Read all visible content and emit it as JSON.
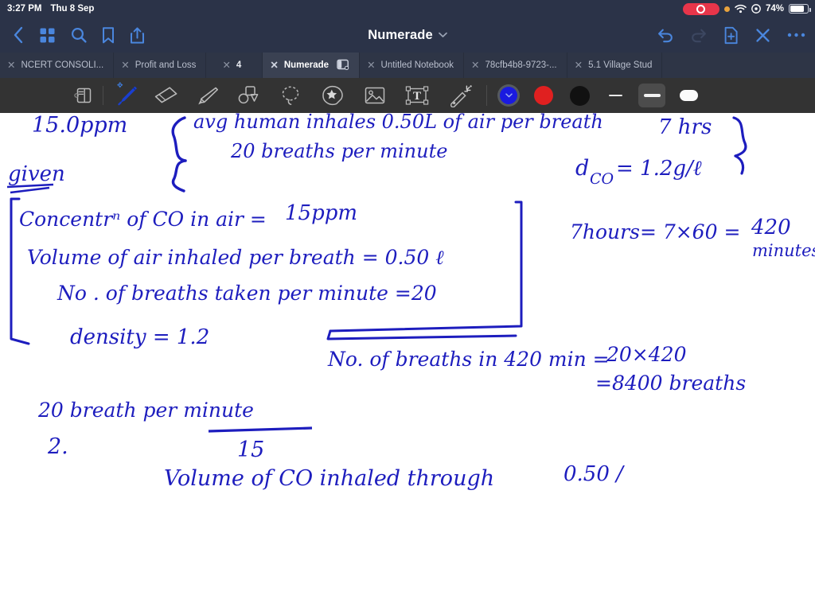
{
  "status_bar": {
    "time": "3:27 PM",
    "date": "Thu 8 Sep",
    "battery_percent": "74%",
    "icons": [
      "record-pill-icon",
      "orange-dot-icon",
      "wifi-icon",
      "location-icon",
      "battery-icon"
    ],
    "colors": {
      "background": "#2b3348",
      "record_red": "#e8354a",
      "orange": "#e8a33d",
      "text": "#ffffff"
    }
  },
  "nav_bar": {
    "title": "Numerade",
    "title_chevron": "chevron-down-icon",
    "left_buttons": [
      {
        "name": "back-button",
        "icon": "chevron-left-icon",
        "label": "Back"
      },
      {
        "name": "library-grid-button",
        "icon": "grid-icon",
        "label": "Library"
      },
      {
        "name": "search-button",
        "icon": "search-icon",
        "label": "Search"
      },
      {
        "name": "bookmark-button",
        "icon": "bookmark-icon",
        "label": "Bookmark"
      },
      {
        "name": "share-button",
        "icon": "share-icon",
        "label": "Share"
      }
    ],
    "right_buttons": [
      {
        "name": "undo-button",
        "icon": "undo-icon",
        "label": "Undo",
        "enabled": true
      },
      {
        "name": "redo-button",
        "icon": "redo-icon",
        "label": "Redo",
        "enabled": false
      },
      {
        "name": "new-page-button",
        "icon": "document-plus-icon",
        "label": "New Page",
        "enabled": true
      },
      {
        "name": "close-button",
        "icon": "close-x-icon",
        "label": "Close",
        "enabled": true
      },
      {
        "name": "more-button",
        "icon": "ellipsis-icon",
        "label": "More",
        "enabled": true
      }
    ],
    "colors": {
      "background": "#2b3348",
      "accent": "#4a7fd4"
    }
  },
  "tab_bar": {
    "tabs": [
      {
        "label": "NCERT CONSOLI...",
        "active": false,
        "close_icon": "close-x-icon"
      },
      {
        "label": "Profit and Loss",
        "active": false,
        "close_icon": "close-x-icon"
      },
      {
        "label": "4",
        "active": false,
        "close_icon": "close-x-icon"
      },
      {
        "label": "Numerade",
        "active": true,
        "close_icon": "close-x-icon",
        "split_icon": "split-view-icon"
      },
      {
        "label": "Untitled Notebook",
        "active": false,
        "close_icon": "close-x-icon"
      },
      {
        "label": "78cfb4b8-9723-...",
        "active": false,
        "close_icon": "close-x-icon"
      },
      {
        "label": "5.1 Village Stud",
        "active": false,
        "close_icon": "close-x-icon"
      }
    ],
    "colors": {
      "background": "#2e3546",
      "active_background": "#3a4152",
      "text": "#b9bfcd"
    }
  },
  "tool_bar": {
    "tools": [
      {
        "name": "page-layout-tool",
        "icon": "page-layout-icon",
        "label": "Page Layout",
        "selected": false
      },
      {
        "name": "pen-tool",
        "icon": "pen-icon",
        "label": "Pen",
        "selected": true,
        "badge": "bluetooth-icon"
      },
      {
        "name": "eraser-tool",
        "icon": "eraser-icon",
        "label": "Eraser",
        "selected": false
      },
      {
        "name": "highlighter-tool",
        "icon": "highlighter-icon",
        "label": "Highlighter",
        "selected": false
      },
      {
        "name": "shapes-tool",
        "icon": "shapes-icon",
        "label": "Shapes",
        "selected": false
      },
      {
        "name": "lasso-tool",
        "icon": "lasso-icon",
        "label": "Lasso",
        "selected": false
      },
      {
        "name": "sticker-tool",
        "icon": "sticker-star-icon",
        "label": "Sticker",
        "selected": false
      },
      {
        "name": "image-tool",
        "icon": "image-icon",
        "label": "Image",
        "selected": false
      },
      {
        "name": "text-tool",
        "icon": "text-box-icon",
        "label": "Text",
        "selected": false
      },
      {
        "name": "magic-wand-tool",
        "icon": "magic-wand-icon",
        "label": "Magic Wand",
        "selected": false
      }
    ],
    "colors_palette": [
      {
        "name": "color-swatch-blue",
        "hex": "#1a1ae0",
        "selected": true,
        "chevron": "chevron-down-icon"
      },
      {
        "name": "color-swatch-red",
        "hex": "#e02020",
        "selected": false
      },
      {
        "name": "color-swatch-black",
        "hex": "#111111",
        "selected": false
      }
    ],
    "stroke_widths": [
      {
        "name": "stroke-thin",
        "label": "Thin",
        "selected": false
      },
      {
        "name": "stroke-medium",
        "label": "Medium",
        "selected": true
      },
      {
        "name": "stroke-thick",
        "label": "Thick",
        "selected": false
      }
    ],
    "colors": {
      "background": "#333333",
      "selected_background": "#4c4c4c"
    }
  },
  "canvas": {
    "ink_color": "#1d1dbe",
    "background": "#ffffff",
    "notes": [
      {
        "name": "note-ppm-value",
        "text": "15.0ppm"
      },
      {
        "name": "note-avg-human-line1",
        "text": "avg human inhales 0.50L of air per breath"
      },
      {
        "name": "note-avg-human-line2",
        "text": "20 breaths per minute"
      },
      {
        "name": "note-hours",
        "text": "7 hrs"
      },
      {
        "name": "note-density-co",
        "text": "d",
        "sub": "CO",
        "rest": "= 1.2g/ℓ"
      },
      {
        "name": "note-given-label",
        "text": "given"
      },
      {
        "name": "note-given-line1",
        "text": "Concentrⁿ of CO in air ="
      },
      {
        "name": "note-given-line1-value",
        "text": "15ppm"
      },
      {
        "name": "note-given-line2",
        "text": "Volume of air inhaled per breath = 0.50 ℓ"
      },
      {
        "name": "note-given-line3",
        "text": "No. of breaths taken per minute =20"
      },
      {
        "name": "note-given-line4",
        "text": "density  = 1.2"
      },
      {
        "name": "note-hours-calc",
        "text": "7hours=  7×60 ="
      },
      {
        "name": "note-hours-calc-value",
        "text": "420"
      },
      {
        "name": "note-hours-calc-unit",
        "text": "minutes"
      },
      {
        "name": "note-breaths-calc",
        "text": "No. of breaths in 420 min ="
      },
      {
        "name": "note-breaths-calc-value",
        "text": "20×420"
      },
      {
        "name": "note-breaths-calc-result",
        "text": "=8400  breaths"
      },
      {
        "name": "note-breath-per-minute",
        "text": "20   breath  per minute"
      },
      {
        "name": "note-step-2",
        "text": "2."
      },
      {
        "name": "note-fraction-denominator",
        "text": "15"
      },
      {
        "name": "note-volume-co",
        "text": "Volume  of   CO inhaled  through"
      },
      {
        "name": "note-volume-co-value",
        "text": "0.50 l"
      }
    ]
  }
}
